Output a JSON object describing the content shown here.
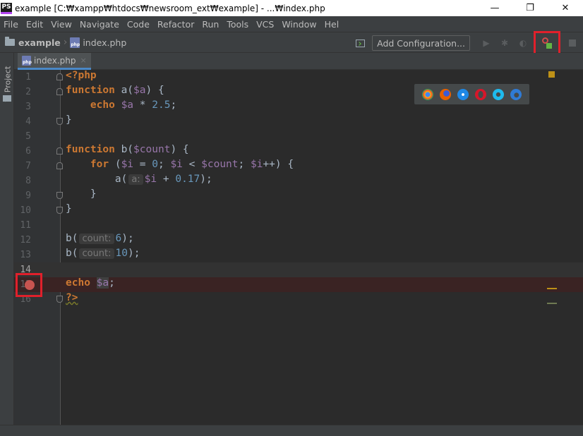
{
  "window": {
    "title": "example [C:₩xampp₩htdocs₩newsroom_ext₩example] - ...₩index.php [examp",
    "app_icon_text": "PS",
    "minimize": "—",
    "restore": "❐",
    "close": "✕"
  },
  "menu": [
    "File",
    "Edit",
    "View",
    "Navigate",
    "Code",
    "Refactor",
    "Run",
    "Tools",
    "VCS",
    "Window",
    "Hel"
  ],
  "navbar": {
    "project": "example",
    "file": "index.php",
    "add_configuration": "Add Configuration..."
  },
  "toolstrip": {
    "project_tab": "1: Project"
  },
  "editor_tab": {
    "label": "index.php",
    "close": "×"
  },
  "file_icon_text": "php",
  "lines": {
    "1": "1",
    "2": "2",
    "3": "3",
    "4": "4",
    "5": "5",
    "6": "6",
    "7": "7",
    "8": "8",
    "9": "9",
    "10": "10",
    "11": "11",
    "12": "12",
    "13": "13",
    "14": "14",
    "15": "15",
    "16": "16"
  },
  "code": {
    "l1": "<?php",
    "l2_kw": "function",
    "l2_rest_a": " a(",
    "l2_var": "$a",
    "l2_rest_b": ") {",
    "l3_kw": "    echo",
    "l3_var": " $a",
    "l3_op": " * ",
    "l3_num": "2.5",
    "l3_end": ";",
    "l4": "}",
    "l6_kw": "function",
    "l6_rest_a": " b(",
    "l6_var": "$count",
    "l6_rest_b": ") {",
    "l7_kw": "    for",
    "l7_a": " (",
    "l7_v1": "$i",
    "l7_b": " = ",
    "l7_n0": "0",
    "l7_c": "; ",
    "l7_v2": "$i",
    "l7_d": " < ",
    "l7_v3": "$count",
    "l7_e": "; ",
    "l7_v4": "$i",
    "l7_f": "++) {",
    "l8_a": "        a(",
    "l8_hint": "a:",
    "l8_var": "$i",
    "l8_b": " + ",
    "l8_num": "0.17",
    "l8_c": ");",
    "l9": "    }",
    "l10": "}",
    "l12_a": "b(",
    "l12_hint": "count:",
    "l12_num": "6",
    "l12_b": ");",
    "l13_a": "b(",
    "l13_hint": "count:",
    "l13_num": "10",
    "l13_b": ");",
    "l15_kw": "echo",
    "l15_sp": " ",
    "l15_var": "$a",
    "l15_end": ";",
    "l16": "?>"
  },
  "browsers": [
    "chrome-icon",
    "firefox-icon",
    "safari-icon",
    "opera-icon",
    "ie-icon",
    "edge-icon"
  ],
  "colors": {
    "keyword": "#cc7832",
    "variable": "#9876aa",
    "number": "#6897bb",
    "highlight_box": "#e0202b",
    "breakpoint": "#c75450"
  }
}
